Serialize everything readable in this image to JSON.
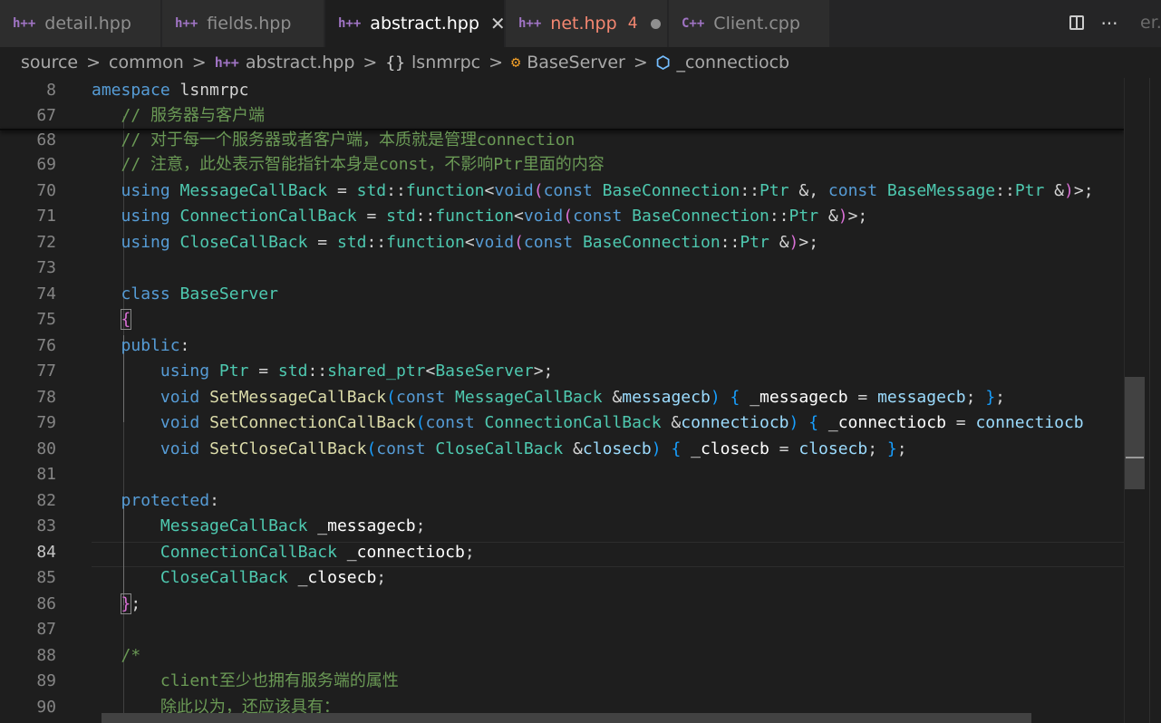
{
  "tabs": [
    {
      "icon": "h++",
      "label": "detail.hpp"
    },
    {
      "icon": "h++",
      "label": "fields.hpp"
    },
    {
      "icon": "h++",
      "label": "abstract.hpp",
      "close": "✕"
    },
    {
      "icon": "h++",
      "label": "net.hpp",
      "errors": "4"
    },
    {
      "icon": "C++",
      "label": "Client.cpp"
    }
  ],
  "cut_tab_text": "er.c",
  "breadcrumb": {
    "items": [
      "source",
      "common",
      "abstract.hpp",
      "lsnmrpc",
      "BaseServer",
      "_connectiocb"
    ],
    "icons": {
      "file": "h++",
      "namespace": "{}",
      "class": "class-icon",
      "field": "field-icon"
    },
    "separator": ">"
  },
  "editor": {
    "current_line": "84",
    "lines": [
      {
        "n": "8"
      },
      {
        "n": "67"
      },
      {
        "n": "68"
      },
      {
        "n": "69"
      },
      {
        "n": "70"
      },
      {
        "n": "71"
      },
      {
        "n": "72"
      },
      {
        "n": "73"
      },
      {
        "n": "74"
      },
      {
        "n": "75"
      },
      {
        "n": "76"
      },
      {
        "n": "77"
      },
      {
        "n": "78"
      },
      {
        "n": "79"
      },
      {
        "n": "80"
      },
      {
        "n": "81"
      },
      {
        "n": "82"
      },
      {
        "n": "83"
      },
      {
        "n": "84"
      },
      {
        "n": "85"
      },
      {
        "n": "86"
      },
      {
        "n": "87"
      },
      {
        "n": "88"
      },
      {
        "n": "89"
      },
      {
        "n": "90"
      }
    ],
    "text": {
      "l8_kw": "amespace",
      "l8_name": "lsnmrpc",
      "l67": "// 服务器与客户端",
      "l68": "// 对于每一个服务器或者客户端，本质就是管理connection",
      "l69": "// 注意，此处表示智能指针本身是const，不影响Ptr里面的内容",
      "using": "using",
      "std": "std",
      "function": "function",
      "void": "void",
      "const": "const",
      "BaseConnection": "BaseConnection",
      "Ptr": "Ptr",
      "BaseMessage": "BaseMessage",
      "MessageCallBack": "MessageCallBack",
      "ConnectionCallBack": "ConnectionCallBack",
      "CloseCallBack": "CloseCallBack",
      "class": "class",
      "BaseServer": "BaseServer",
      "public": "public",
      "protected": "protected",
      "shared_ptr": "shared_ptr",
      "SetMessageCallBack": "SetMessageCallBack",
      "SetConnectionCallBack": "SetConnectionCallBack",
      "SetCloseCallBack": "SetCloseCallBack",
      "messagecb": "messagecb",
      "connectiocb": "connectiocb",
      "closecb": "closecb",
      "_messagecb": "_messagecb",
      "_connectiocb": "_connectiocb",
      "_closecb": "_closecb",
      "connectiocb_cut": "connectiocb",
      "l88": "/*",
      "l89": "client至少也拥有服务端的属性",
      "l90": "除此以为，还应该具有："
    }
  },
  "actions": {
    "split_icon": "split-editor-icon",
    "more_label": "···"
  }
}
